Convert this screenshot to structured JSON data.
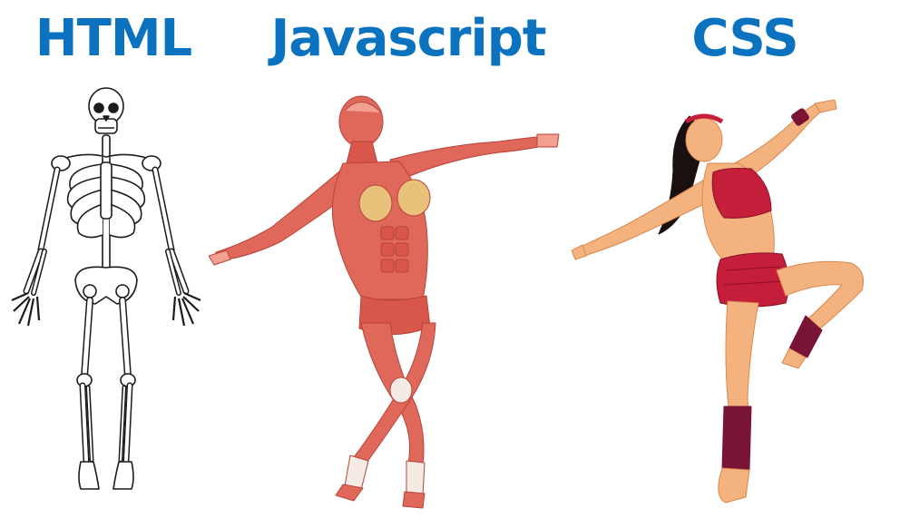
{
  "colors": {
    "title": "#0a72bf",
    "bone_stroke": "#1c1c1c",
    "bone_fill": "#ffffff",
    "muscle": "#e0685a",
    "muscle_dark": "#b8423a",
    "muscle_light": "#f2a08f",
    "tendon": "#f4ece4",
    "fat": "#e8c27a",
    "skin": "#f3b27e",
    "skin_shade": "#d9894f",
    "outfit": "#c41e3a",
    "outfit_dark": "#8a1028",
    "legwarmer": "#7a1434",
    "hair": "#1a1010"
  },
  "panels": [
    {
      "id": "html",
      "title": "HTML",
      "figure": "skeleton-figure"
    },
    {
      "id": "javascript",
      "title": "Javascript",
      "figure": "muscle-figure"
    },
    {
      "id": "css",
      "title": "CSS",
      "figure": "dancer-figure"
    }
  ]
}
